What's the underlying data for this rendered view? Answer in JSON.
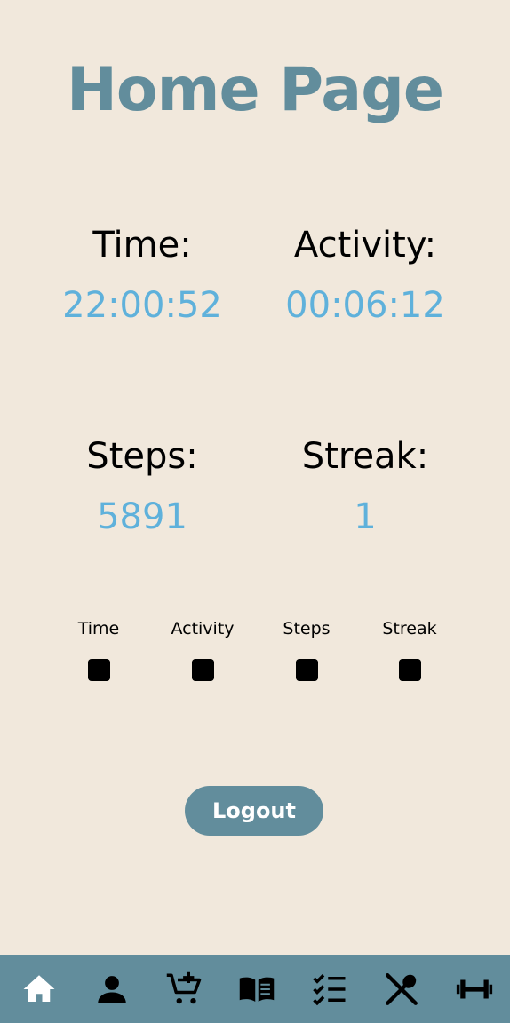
{
  "page": {
    "title": "Home Page"
  },
  "stats": {
    "time": {
      "label": "Time:",
      "value": "22:00:52"
    },
    "activity": {
      "label": "Activity:",
      "value": "00:06:12"
    },
    "steps": {
      "label": "Steps:",
      "value": "5891"
    },
    "streak": {
      "label": "Streak:",
      "value": "1"
    }
  },
  "toggles": [
    {
      "label": "Time",
      "checked": false
    },
    {
      "label": "Activity",
      "checked": false
    },
    {
      "label": "Steps",
      "checked": false
    },
    {
      "label": "Streak",
      "checked": false
    }
  ],
  "actions": {
    "logout_label": "Logout"
  },
  "navbar": {
    "items": [
      {
        "icon": "home-icon",
        "active": true
      },
      {
        "icon": "profile-icon",
        "active": false
      },
      {
        "icon": "cart-add-icon",
        "active": false
      },
      {
        "icon": "book-icon",
        "active": false
      },
      {
        "icon": "checklist-icon",
        "active": false
      },
      {
        "icon": "utensils-icon",
        "active": false
      },
      {
        "icon": "dumbbell-icon",
        "active": false
      }
    ]
  },
  "colors": {
    "background": "#f1e8dc",
    "accent": "#628d9c",
    "value": "#5fb1db"
  }
}
